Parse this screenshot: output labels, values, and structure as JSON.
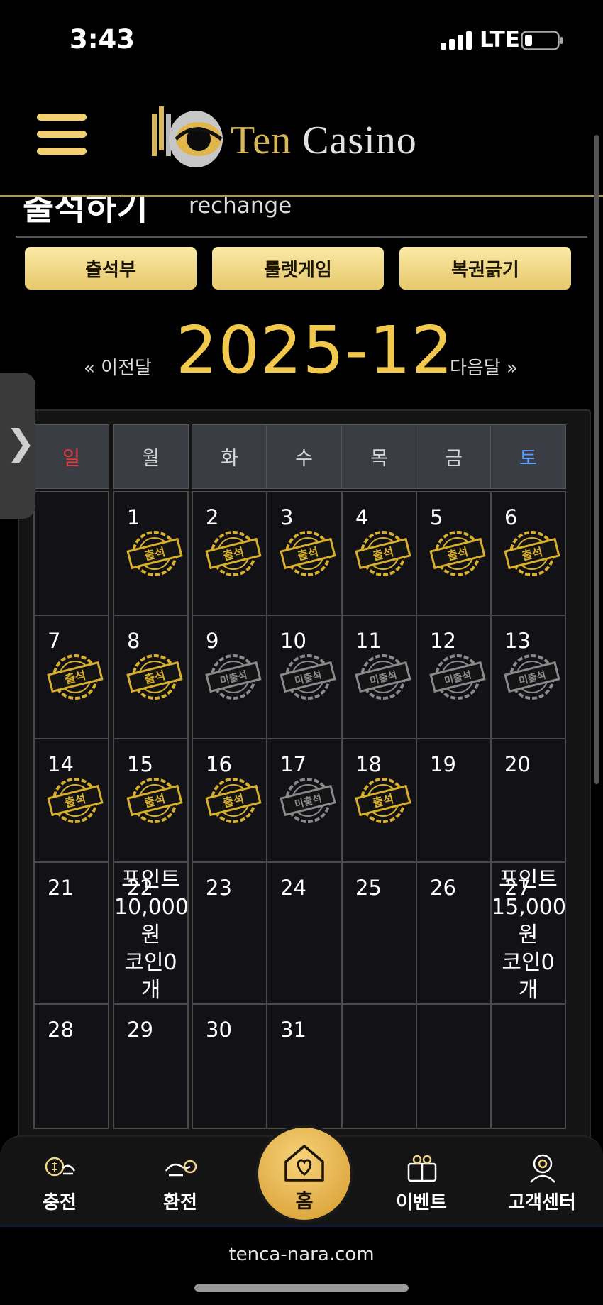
{
  "status": {
    "time": "3:43",
    "network": "LTE"
  },
  "header": {
    "logo_ten": "Ten",
    "logo_casino": "Casino"
  },
  "page": {
    "title": "출석하기",
    "subtitle": "rechange"
  },
  "tabs": [
    "출석부",
    "룰렛게임",
    "복권긁기"
  ],
  "nav": {
    "prev": "« 이전달",
    "month": "2025-12",
    "next": "다음달 »"
  },
  "calendar": {
    "weekdays": [
      "일",
      "월",
      "화",
      "수",
      "목",
      "금",
      "토"
    ],
    "weekday_colors": [
      "#e03a3a",
      "#d6d6d6",
      "#d6d6d6",
      "#d6d6d6",
      "#d6d6d6",
      "#d6d6d6",
      "#5aa0ff"
    ],
    "stamp_attend_label": "출석",
    "stamp_absent_label": "미출석",
    "stamp_attend_color": "#d9b02c",
    "stamp_absent_color": "#8a8a8a",
    "weeks": [
      [
        {
          "day": ""
        },
        {
          "day": "1",
          "stamp": "attend"
        },
        {
          "day": "2",
          "stamp": "attend"
        },
        {
          "day": "3",
          "stamp": "attend"
        },
        {
          "day": "4",
          "stamp": "attend"
        },
        {
          "day": "5",
          "stamp": "attend"
        },
        {
          "day": "6",
          "stamp": "attend"
        }
      ],
      [
        {
          "day": "7",
          "stamp": "attend"
        },
        {
          "day": "8",
          "stamp": "attend"
        },
        {
          "day": "9",
          "stamp": "absent"
        },
        {
          "day": "10",
          "stamp": "absent"
        },
        {
          "day": "11",
          "stamp": "absent"
        },
        {
          "day": "12",
          "stamp": "absent"
        },
        {
          "day": "13",
          "stamp": "absent"
        }
      ],
      [
        {
          "day": "14",
          "stamp": "attend"
        },
        {
          "day": "15",
          "stamp": "attend"
        },
        {
          "day": "16",
          "stamp": "attend"
        },
        {
          "day": "17",
          "stamp": "absent"
        },
        {
          "day": "18",
          "stamp": "attend"
        },
        {
          "day": "19"
        },
        {
          "day": "20"
        }
      ],
      [
        {
          "day": "21"
        },
        {
          "day": "22",
          "reward": "포인트\n10,000\n원\n코인0\n개"
        },
        {
          "day": "23"
        },
        {
          "day": "24"
        },
        {
          "day": "25"
        },
        {
          "day": "26"
        },
        {
          "day": "27",
          "reward": "포인트\n15,000\n원\n코인0\n개"
        }
      ],
      [
        {
          "day": "28"
        },
        {
          "day": "29"
        },
        {
          "day": "30"
        },
        {
          "day": "31"
        },
        {
          "day": ""
        },
        {
          "day": ""
        },
        {
          "day": ""
        }
      ]
    ]
  },
  "bottom_nav": {
    "items": [
      {
        "label": "충전",
        "icon": "charge-icon"
      },
      {
        "label": "환전",
        "icon": "exchange-icon"
      },
      {
        "label": "홈",
        "icon": "home-heart-icon"
      },
      {
        "label": "이벤트",
        "icon": "gift-icon"
      },
      {
        "label": "고객센터",
        "icon": "support-icon"
      }
    ]
  },
  "browser": {
    "url": "tenca-nara.com"
  },
  "colors": {
    "accent": "#f2c94c",
    "button": "#f0d587",
    "background": "#000000"
  }
}
